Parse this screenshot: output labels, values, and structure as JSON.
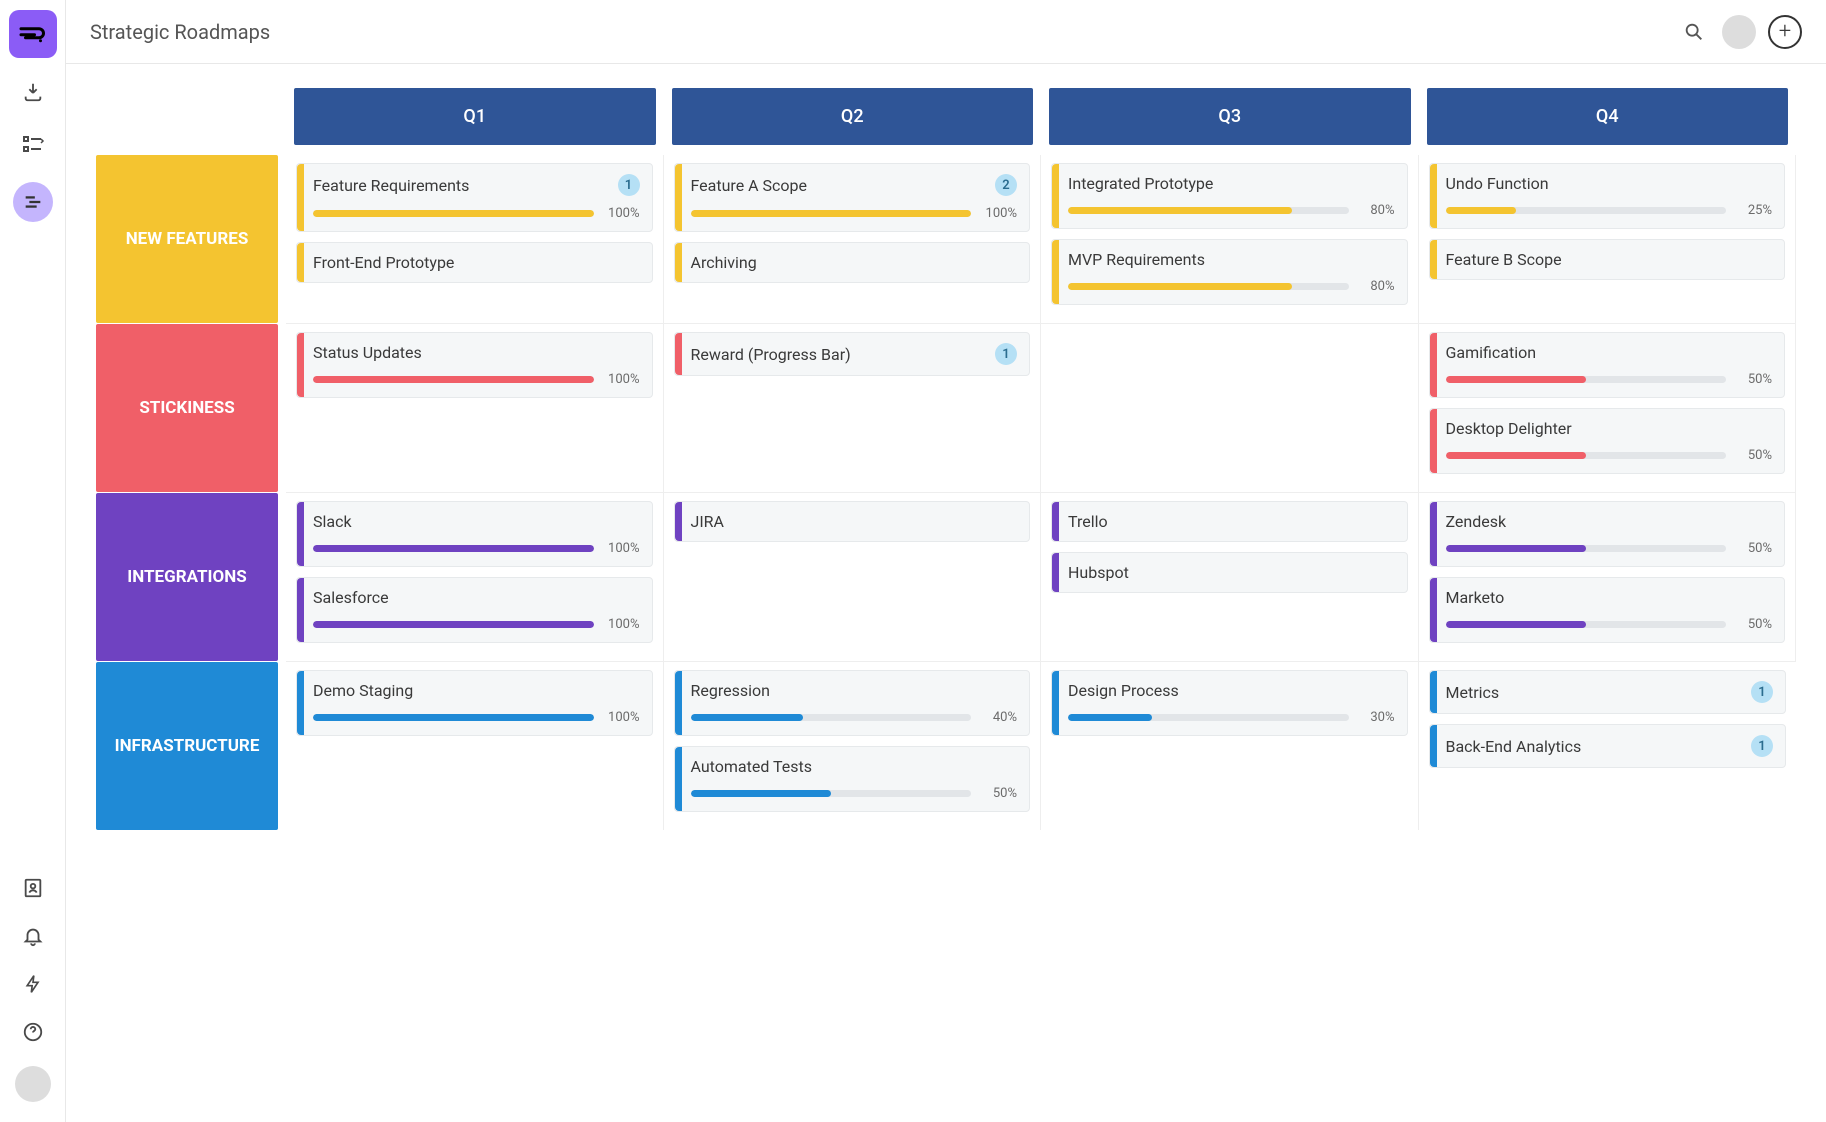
{
  "header": {
    "title": "Strategic Roadmaps"
  },
  "columns": [
    "Q1",
    "Q2",
    "Q3",
    "Q4"
  ],
  "lanes": [
    {
      "id": "new-features",
      "label": "NEW FEATURES",
      "color": "#f4c430",
      "cells": [
        [
          {
            "title": "Feature Requirements",
            "badge": "1",
            "progress": 100
          },
          {
            "title": "Front-End Prototype"
          }
        ],
        [
          {
            "title": "Feature A Scope",
            "badge": "2",
            "progress": 100
          },
          {
            "title": "Archiving"
          }
        ],
        [
          {
            "title": "Integrated Prototype",
            "progress": 80
          },
          {
            "title": "MVP Requirements",
            "progress": 80
          }
        ],
        [
          {
            "title": "Undo Function",
            "progress": 25
          },
          {
            "title": "Feature B Scope"
          }
        ]
      ]
    },
    {
      "id": "stickiness",
      "label": "STICKINESS",
      "color": "#f05f68",
      "cells": [
        [
          {
            "title": "Status Updates",
            "progress": 100
          }
        ],
        [
          {
            "title": "Reward (Progress Bar)",
            "badge": "1"
          }
        ],
        [],
        [
          {
            "title": "Gamification",
            "progress": 50
          },
          {
            "title": "Desktop Delighter",
            "progress": 50
          }
        ]
      ]
    },
    {
      "id": "integrations",
      "label": "INTEGRATIONS",
      "color": "#6f42c1",
      "cells": [
        [
          {
            "title": "Slack",
            "progress": 100
          },
          {
            "title": "Salesforce",
            "progress": 100
          }
        ],
        [
          {
            "title": "JIRA"
          }
        ],
        [
          {
            "title": "Trello"
          },
          {
            "title": "Hubspot"
          }
        ],
        [
          {
            "title": "Zendesk",
            "progress": 50
          },
          {
            "title": "Marketo",
            "progress": 50
          }
        ]
      ]
    },
    {
      "id": "infrastructure",
      "label": "INFRASTRUCTURE",
      "color": "#1f8ad6",
      "cells": [
        [
          {
            "title": "Demo Staging",
            "progress": 100
          }
        ],
        [
          {
            "title": "Regression",
            "progress": 40
          },
          {
            "title": "Automated Tests",
            "progress": 50
          }
        ],
        [
          {
            "title": "Design Process",
            "progress": 30
          }
        ],
        [
          {
            "title": "Metrics",
            "badge": "1"
          },
          {
            "title": "Back-End Analytics",
            "badge": "1"
          }
        ]
      ]
    }
  ]
}
